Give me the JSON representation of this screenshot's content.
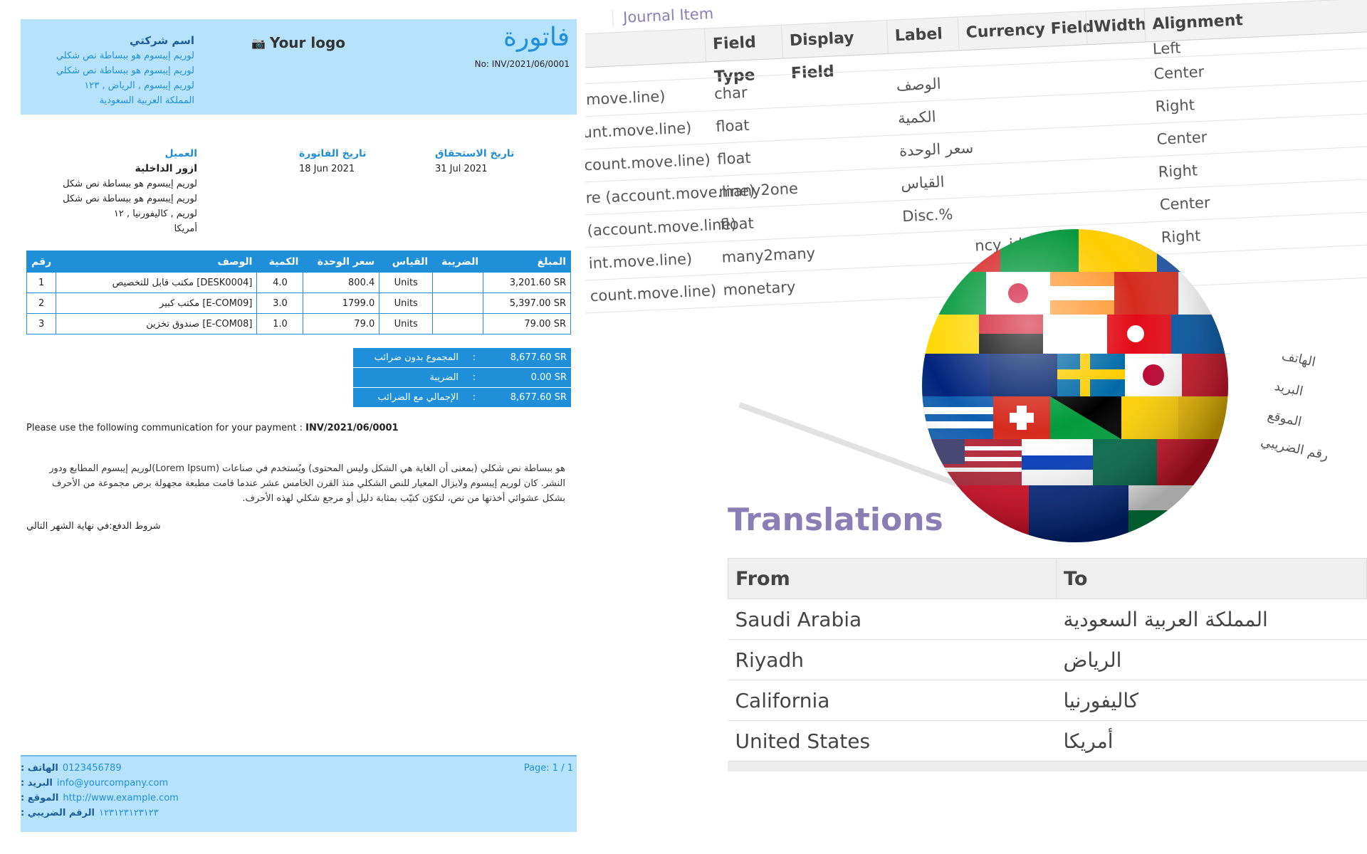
{
  "invoice": {
    "title": "فاتورة",
    "number": "No: INV/2021/06/0001",
    "logo_text": "Your logo",
    "company": {
      "name": "اسم شركتي",
      "lines": [
        "لوريم إيبسوم هو ببساطة نص شكلي",
        "لوريم إيبسوم هو ببساطة نص شكلي",
        "لوريم إيبسوم , الرياض , ١٢٣",
        "المملكة العربية السعودية"
      ]
    },
    "customer": {
      "label": "العميل",
      "name": "ازور الداخلية",
      "lines": [
        "لوريم إيبسوم هو ببساطة نص شكل",
        "لوريم إيبسوم هو ببساطة نص شكل",
        "لوريم , كاليفورنيا , ١٢",
        "أمريكا"
      ]
    },
    "invoice_date": {
      "label": "تاريخ الفاتورة",
      "value": "18 Jun 2021"
    },
    "due_date": {
      "label": "تاريخ الاستحقاق",
      "value": "31 Jul 2021"
    },
    "table": {
      "headers": {
        "num": "رقم",
        "desc": "الوصف",
        "qty": "الكمية",
        "price": "سعر الوحدة",
        "uom": "القياس",
        "tax": "الضريبة",
        "amount": "المبلغ"
      },
      "rows": [
        {
          "num": "1",
          "desc": "[DESK0004] مكتب قابل للتخصيص",
          "qty": "4.0",
          "price": "800.4",
          "uom": "Units",
          "tax": "",
          "amount": "3,201.60 SR"
        },
        {
          "num": "2",
          "desc": "[E-COM09] مكتب كبير",
          "qty": "3.0",
          "price": "1799.0",
          "uom": "Units",
          "tax": "",
          "amount": "5,397.00 SR"
        },
        {
          "num": "3",
          "desc": "[E-COM08] صندوق تخزين",
          "qty": "1.0",
          "price": "79.0",
          "uom": "Units",
          "tax": "",
          "amount": "79.00 SR"
        }
      ]
    },
    "totals": [
      {
        "label": "المجموع بدون ضرائب",
        "colon": ":",
        "value": "8,677.60 SR"
      },
      {
        "label": "الضريبة",
        "colon": ":",
        "value": "0.00 SR"
      },
      {
        "label": "الإجمالي مع الضرائب",
        "colon": ":",
        "value": "8,677.60 SR"
      }
    ],
    "payment_text": "Please use the following communication for your payment : ",
    "payment_ref": "INV/2021/06/0001",
    "lorem_text": "هو ببساطة نص شكلي (بمعنى أن الغاية هي الشكل وليس المحتوى) ويُستخدم في صناعات (Lorem Ipsum)لوريم إيبسوم المطابع ودور النشر. كان لوريم إيبسوم ولايزال المعيار للنص الشكلي منذ القرن الخامس عشر عندما قامت مطبعة مجهولة برص مجموعة من الأحرف بشكل عشوائي أخذتها من نص، لتكوّن كتيّب بمثابة دليل أو مرجع شكلي لهذه الأحرف.",
    "payment_terms": "شروط الدفع:في نهاية الشهر التالي",
    "footer": {
      "phone_label": "الهاتف :",
      "phone": "0123456789",
      "email_label": "البريد :",
      "email": "info@yourcompany.com",
      "web_label": "الموقع :",
      "web": "http://www.example.com",
      "tax_label": "الرقم الضريبي :",
      "tax": "١٢٣١٢٣١٢٣١٢٣",
      "page": "Page: 1 / 1"
    }
  },
  "config": {
    "tab": "Journal Item",
    "headers": {
      "field_type": "Field Type",
      "display_field": "Display Field",
      "label": "Label",
      "currency_field": "Currency Field",
      "width": "Width",
      "alignment": "Alignment"
    },
    "rows": [
      {
        "field": "",
        "type": "",
        "label": "",
        "currency": "",
        "align": "Left"
      },
      {
        "field": ".move.line)",
        "type": "char",
        "label": "الوصف",
        "currency": "",
        "align": "Center"
      },
      {
        "field": "unt.move.line)",
        "type": "float",
        "label": "الكمية",
        "currency": "",
        "align": "Right"
      },
      {
        "field": "count.move.line)",
        "type": "float",
        "label": "سعر الوحدة",
        "currency": "",
        "align": "Center"
      },
      {
        "field": "re (account.move.line)",
        "type": "many2one",
        "label": "القياس",
        "currency": "",
        "align": "Right"
      },
      {
        "field": "(account.move.line)",
        "type": "float",
        "label": "Disc.%",
        "currency": "",
        "align": "Center"
      },
      {
        "field": "int.move.line)",
        "type": "many2many",
        "label": "",
        "currency": "ncy_id",
        "align": "Right"
      },
      {
        "field": "count.move.line)",
        "type": "monetary",
        "label": "",
        "currency": "",
        "align": ""
      }
    ],
    "side_labels": [
      "الهاتف",
      "البريد",
      "الموقع",
      "رقم الضريبي"
    ]
  },
  "translations": {
    "title": "Translations",
    "headers": {
      "from": "From",
      "to": "To"
    },
    "rows": [
      {
        "from": "Saudi Arabia",
        "to": "المملكة العربية السعودية"
      },
      {
        "from": "Riyadh",
        "to": "الرياض"
      },
      {
        "from": "California",
        "to": "كاليفورنيا"
      },
      {
        "from": "United States",
        "to": "أمريكا"
      }
    ]
  },
  "colors": {
    "accent": "#1e8fd8",
    "header_bg": "#b7e2fb",
    "odoo_purple": "#8a7fb5"
  }
}
